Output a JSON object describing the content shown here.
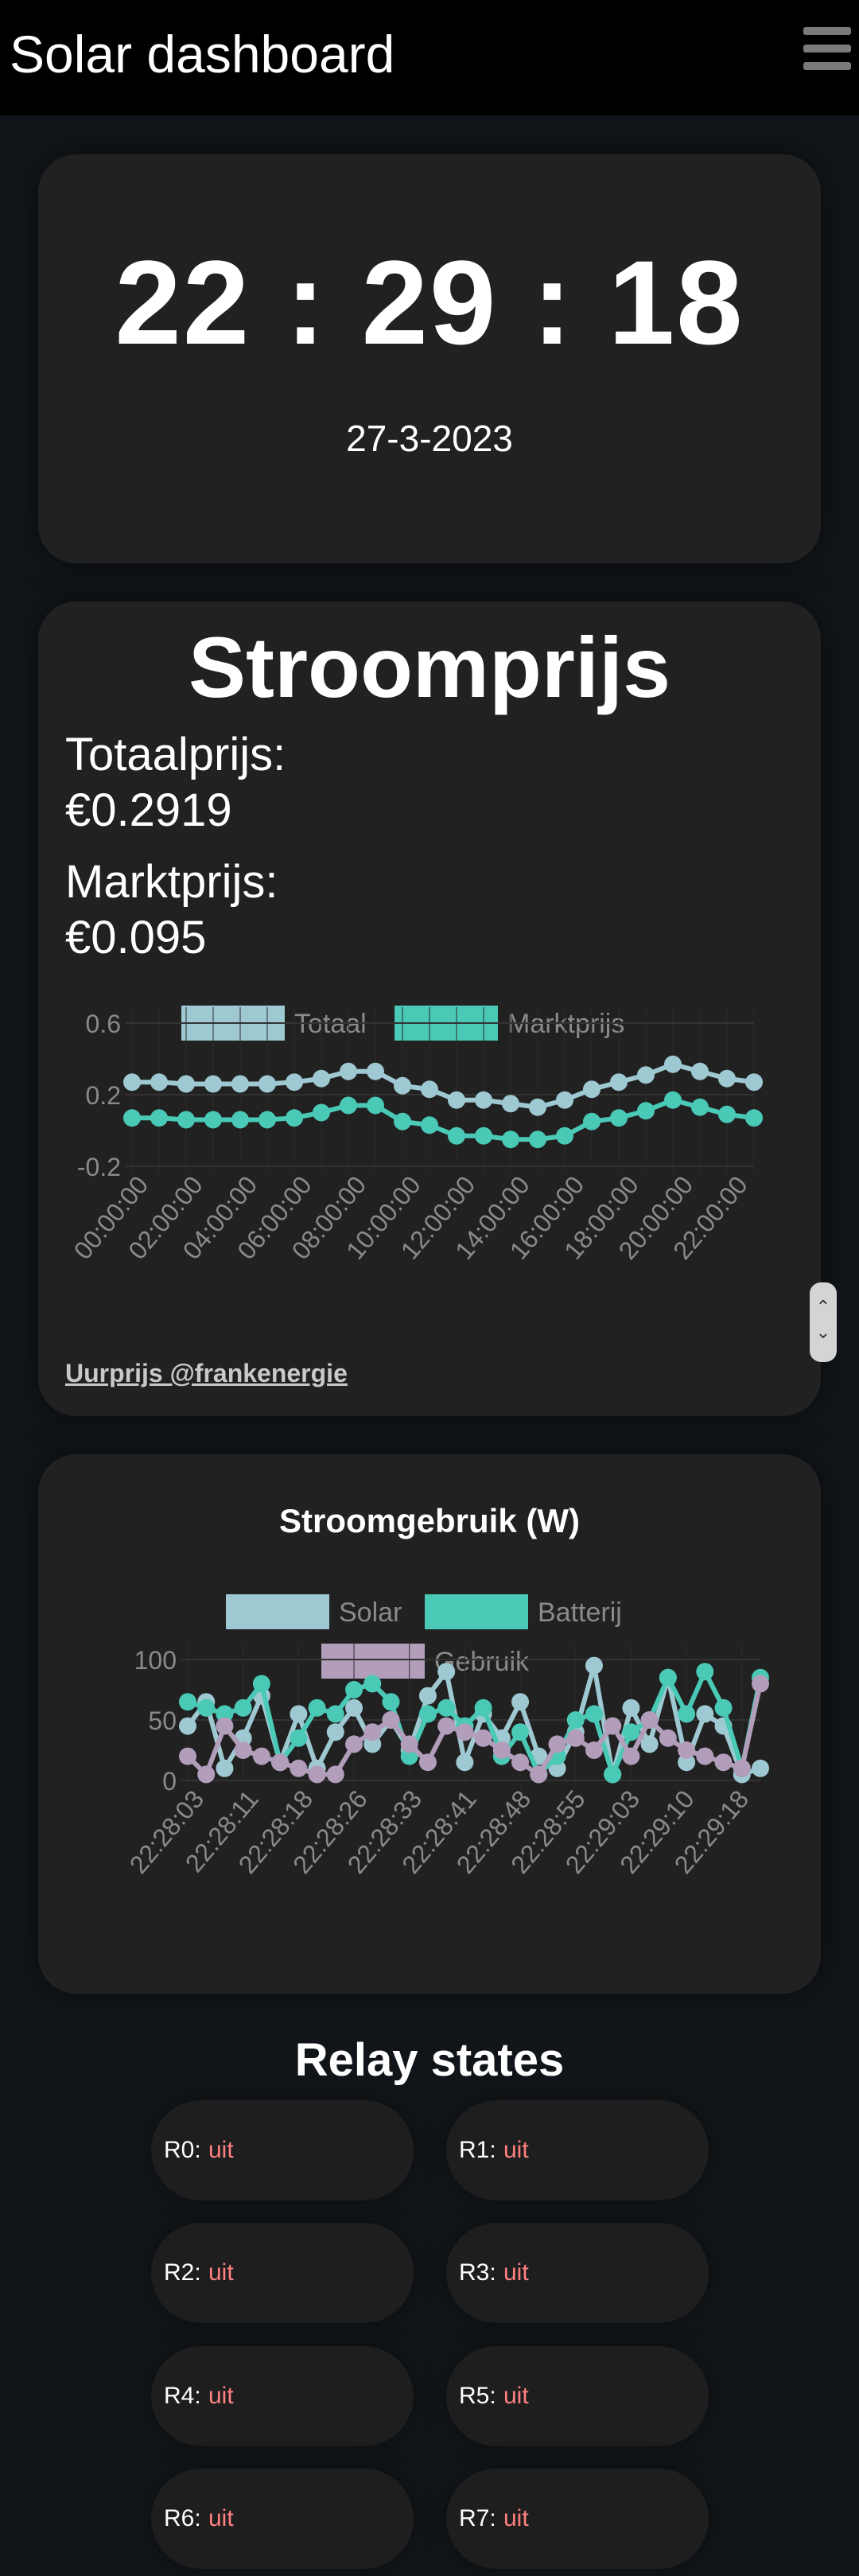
{
  "header": {
    "title": "Solar dashboard",
    "menu_icon": "hamburger-menu-icon"
  },
  "clock": {
    "time": "22 : 29 : 18",
    "date": "27-3-2023"
  },
  "price": {
    "title": "Stroomprijs",
    "total_label": "Totaalprijs:",
    "total_value": "€0.2919",
    "market_label": "Marktprijs:",
    "market_value": "€0.095",
    "source_link": "Uurprijs @frankenergie"
  },
  "usage": {
    "title": "Stroomgebruik (W)"
  },
  "relays": {
    "title": "Relay states",
    "items": [
      {
        "label": "R0:",
        "state": "uit"
      },
      {
        "label": "R1:",
        "state": "uit"
      },
      {
        "label": "R2:",
        "state": "uit"
      },
      {
        "label": "R3:",
        "state": "uit"
      },
      {
        "label": "R4:",
        "state": "uit"
      },
      {
        "label": "R5:",
        "state": "uit"
      },
      {
        "label": "R6:",
        "state": "uit"
      },
      {
        "label": "R7:",
        "state": "uit"
      }
    ]
  },
  "colors": {
    "background": "#111519",
    "card": "#212121",
    "totaal": "#9fc9d2",
    "markt": "#49c9b6",
    "gebruik": "#b29dbb",
    "relay_off": "#ff8080"
  },
  "chart_data": [
    {
      "type": "line",
      "legend": [
        "Totaal",
        "Marktprijs"
      ],
      "legend_position": "top",
      "grid": true,
      "ylim": [
        -0.2,
        0.6
      ],
      "yticks": [
        "0.6",
        "0.2",
        "-0.2"
      ],
      "x": [
        "00:00:00",
        "01:00:00",
        "02:00:00",
        "03:00:00",
        "04:00:00",
        "05:00:00",
        "06:00:00",
        "07:00:00",
        "08:00:00",
        "09:00:00",
        "10:00:00",
        "11:00:00",
        "12:00:00",
        "13:00:00",
        "14:00:00",
        "15:00:00",
        "16:00:00",
        "17:00:00",
        "18:00:00",
        "19:00:00",
        "20:00:00",
        "21:00:00",
        "22:00:00",
        "23:00:00"
      ],
      "xticks": [
        "00:00:00",
        "02:00:00",
        "04:00:00",
        "06:00:00",
        "08:00:00",
        "10:00:00",
        "12:00:00",
        "14:00:00",
        "16:00:00",
        "18:00:00",
        "20:00:00",
        "22:00:00"
      ],
      "series": [
        {
          "name": "Totaal",
          "color": "#9fc9d2",
          "values": [
            0.27,
            0.27,
            0.26,
            0.26,
            0.26,
            0.26,
            0.27,
            0.29,
            0.33,
            0.33,
            0.25,
            0.23,
            0.17,
            0.17,
            0.15,
            0.13,
            0.17,
            0.23,
            0.27,
            0.31,
            0.37,
            0.33,
            0.29,
            0.27
          ]
        },
        {
          "name": "Marktprijs",
          "color": "#49c9b6",
          "values": [
            0.07,
            0.07,
            0.06,
            0.06,
            0.06,
            0.06,
            0.07,
            0.1,
            0.14,
            0.14,
            0.05,
            0.03,
            -0.03,
            -0.03,
            -0.05,
            -0.05,
            -0.03,
            0.05,
            0.07,
            0.11,
            0.17,
            0.13,
            0.09,
            0.07
          ]
        }
      ]
    },
    {
      "type": "line",
      "title": "Stroomgebruik (W)",
      "legend": [
        "Solar",
        "Batterij",
        "Gebruik"
      ],
      "legend_position": "top",
      "grid": true,
      "ylim": [
        0,
        100
      ],
      "yticks": [
        "100",
        "50",
        "0"
      ],
      "xticks": [
        "22:28:03",
        "22:28:11",
        "22:28:18",
        "22:28:26",
        "22:28:33",
        "22:28:41",
        "22:28:48",
        "22:28:55",
        "22:29:03",
        "22:29:10",
        "22:29:18"
      ],
      "series": [
        {
          "name": "Solar",
          "color": "#9fc9d2",
          "values": [
            45,
            65,
            10,
            35,
            70,
            15,
            55,
            10,
            40,
            60,
            30,
            50,
            25,
            70,
            90,
            15,
            55,
            35,
            65,
            20,
            10,
            40,
            95,
            5,
            60,
            30,
            85,
            15,
            55,
            45,
            5,
            10
          ]
        },
        {
          "name": "Batterij",
          "color": "#49c9b6",
          "values": [
            65,
            60,
            55,
            60,
            80,
            15,
            35,
            60,
            55,
            75,
            80,
            65,
            20,
            55,
            60,
            45,
            60,
            20,
            40,
            5,
            20,
            50,
            55,
            5,
            40,
            50,
            85,
            55,
            90,
            60,
            10,
            85
          ]
        },
        {
          "name": "Gebruik",
          "color": "#b29dbb",
          "values": [
            20,
            5,
            45,
            25,
            20,
            15,
            10,
            5,
            5,
            30,
            40,
            50,
            30,
            15,
            45,
            40,
            35,
            25,
            15,
            5,
            30,
            35,
            25,
            45,
            20,
            50,
            35,
            25,
            20,
            15,
            10,
            80
          ]
        }
      ]
    }
  ]
}
